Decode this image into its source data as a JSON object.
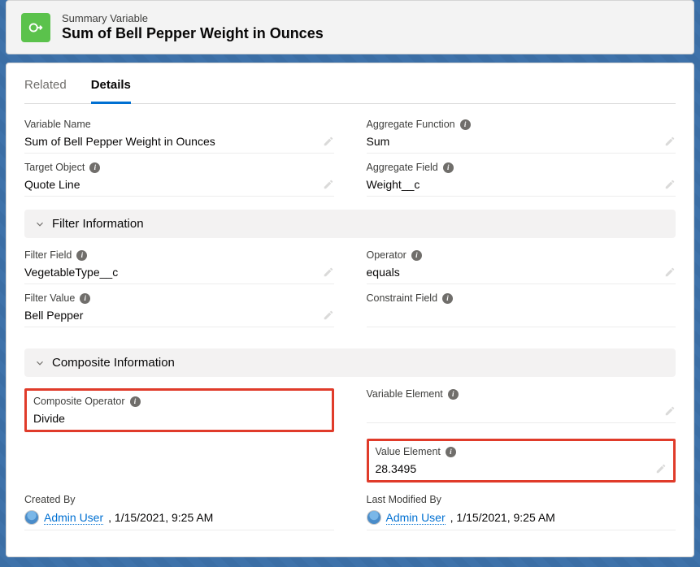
{
  "header": {
    "type_label": "Summary Variable",
    "title": "Sum of Bell Pepper Weight in Ounces"
  },
  "tabs": {
    "related": "Related",
    "details": "Details"
  },
  "sections": {
    "filter": "Filter Information",
    "composite": "Composite Information"
  },
  "labels": {
    "variable_name": "Variable Name",
    "aggregate_function": "Aggregate Function",
    "target_object": "Target Object",
    "aggregate_field": "Aggregate Field",
    "filter_field": "Filter Field",
    "operator": "Operator",
    "filter_value": "Filter Value",
    "constraint_field": "Constraint Field",
    "composite_operator": "Composite Operator",
    "variable_element": "Variable Element",
    "value_element": "Value Element",
    "created_by": "Created By",
    "last_modified_by": "Last Modified By"
  },
  "values": {
    "variable_name": "Sum of Bell Pepper Weight in Ounces",
    "aggregate_function": "Sum",
    "target_object": "Quote Line",
    "aggregate_field": "Weight__c",
    "filter_field": "VegetableType__c",
    "operator": "equals",
    "filter_value": "Bell Pepper",
    "constraint_field": "",
    "composite_operator": "Divide",
    "variable_element": "",
    "value_element": "28.3495",
    "created_by_user": "Admin User",
    "created_by_date": ", 1/15/2021, 9:25 AM",
    "modified_by_user": "Admin User",
    "modified_by_date": ", 1/15/2021, 9:25 AM"
  },
  "colors": {
    "accent": "#0070d2",
    "highlight": "#e03b2a",
    "icon_bg": "#5bc24c"
  }
}
